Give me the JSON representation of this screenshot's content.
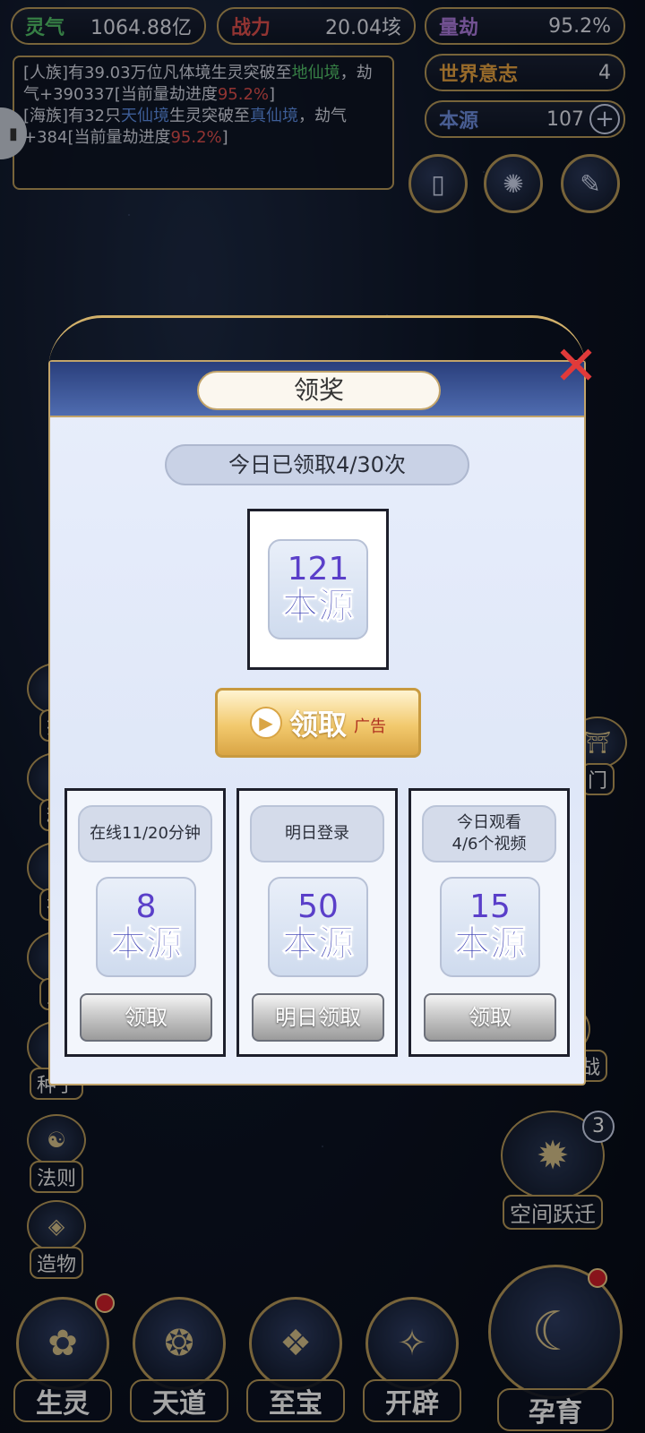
{
  "stats": {
    "lingqi": {
      "label": "灵气",
      "value": "1064.88亿",
      "color": "#54c46a"
    },
    "zhanli": {
      "label": "战力",
      "value": "20.04垓",
      "color": "#e0504e"
    },
    "liangjie": {
      "label": "量劫",
      "value": "95.2%",
      "color": "#b07de0"
    },
    "shijie": {
      "label": "世界意志",
      "value": "4",
      "color": "#e9a441"
    },
    "benyuan": {
      "label": "本源",
      "value": "107",
      "color": "#6f8fe0"
    }
  },
  "log": {
    "line1": {
      "p1": "[人族]有39.03万位凡体境生灵突破至",
      "hl": "地仙境",
      "p2": "，劫气+390337[当前量劫进度",
      "pct": "95.2%",
      "p3": "]"
    },
    "line2": {
      "p1": "[海族]有32只",
      "hl1": "天仙境",
      "p2": "生灵突破至",
      "hl2": "真仙境",
      "p3": "，劫气+384[当前量劫进度",
      "pct": "95.2%",
      "p4": "]"
    }
  },
  "side_left": [
    "扩",
    "精",
    "神",
    "灵",
    "种子",
    "法则",
    "造物"
  ],
  "side_right": [
    "门",
    "洛神之战",
    "空间跃迁"
  ],
  "space_jump_badge": "3",
  "bottom_nav": [
    "生灵",
    "天道",
    "至宝",
    "开辟",
    "孕育"
  ],
  "modal": {
    "title": "领奖",
    "counter": "今日已领取4/30次",
    "main_reward": {
      "amount": "121",
      "name": "本源"
    },
    "ad_button": {
      "label": "领取",
      "tag": "广告"
    },
    "tasks": [
      {
        "head": "在线11/20分钟",
        "amount": "8",
        "name": "本源",
        "button": "领取"
      },
      {
        "head": "明日登录",
        "amount": "50",
        "name": "本源",
        "button": "明日领取"
      },
      {
        "head": "今日观看\n4/6个视频",
        "amount": "15",
        "name": "本源",
        "button": "领取"
      }
    ]
  }
}
